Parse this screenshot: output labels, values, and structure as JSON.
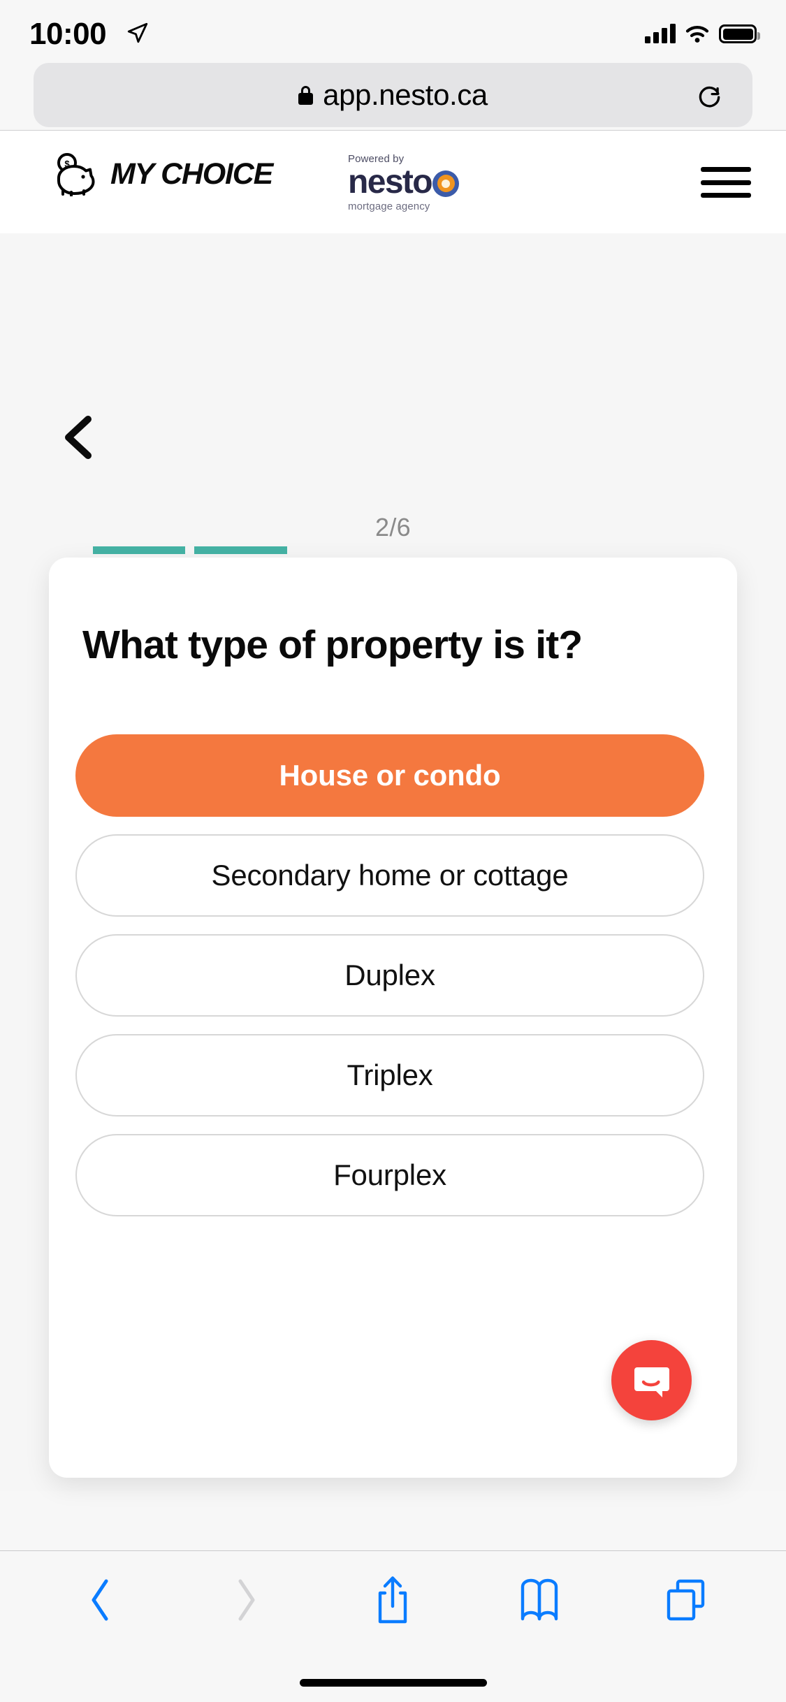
{
  "status_bar": {
    "time": "10:00",
    "location_icon": "location-arrow-icon",
    "signal_icon": "cellular-signal-icon",
    "wifi_icon": "wifi-icon",
    "battery_icon": "battery-full-icon"
  },
  "browser": {
    "url": "app.nesto.ca",
    "lock_icon": "lock-icon",
    "reload_icon": "reload-icon",
    "toolbar": {
      "back_label": "back-icon",
      "forward_label": "forward-icon",
      "share_label": "share-icon",
      "bookmarks_label": "bookmarks-icon",
      "tabs_label": "tabs-icon"
    }
  },
  "site_header": {
    "logo_text": "MY CHOICE",
    "logo_icon": "piggy-bank-icon",
    "partner": {
      "powered_by": "Powered by",
      "name": "nesto",
      "tagline": "mortgage agency"
    },
    "menu_icon": "hamburger-menu-icon"
  },
  "wizard": {
    "back_icon": "chevron-left-icon",
    "step_label": "2/6",
    "current_step": 2,
    "total_steps": 6,
    "question": "What type of property is it?",
    "options": [
      {
        "label": "House or condo",
        "selected": true
      },
      {
        "label": "Secondary home or cottage",
        "selected": false
      },
      {
        "label": "Duplex",
        "selected": false
      },
      {
        "label": "Triplex",
        "selected": false
      },
      {
        "label": "Fourplex",
        "selected": false
      }
    ]
  },
  "chat": {
    "icon": "intercom-chat-icon",
    "label": "Open chat"
  },
  "colors": {
    "accent_orange": "#f4783f",
    "progress_teal": "#45b3a5",
    "chat_red": "#f4433c",
    "nesto_navy": "#282948",
    "safari_blue": "#0a7cff"
  }
}
